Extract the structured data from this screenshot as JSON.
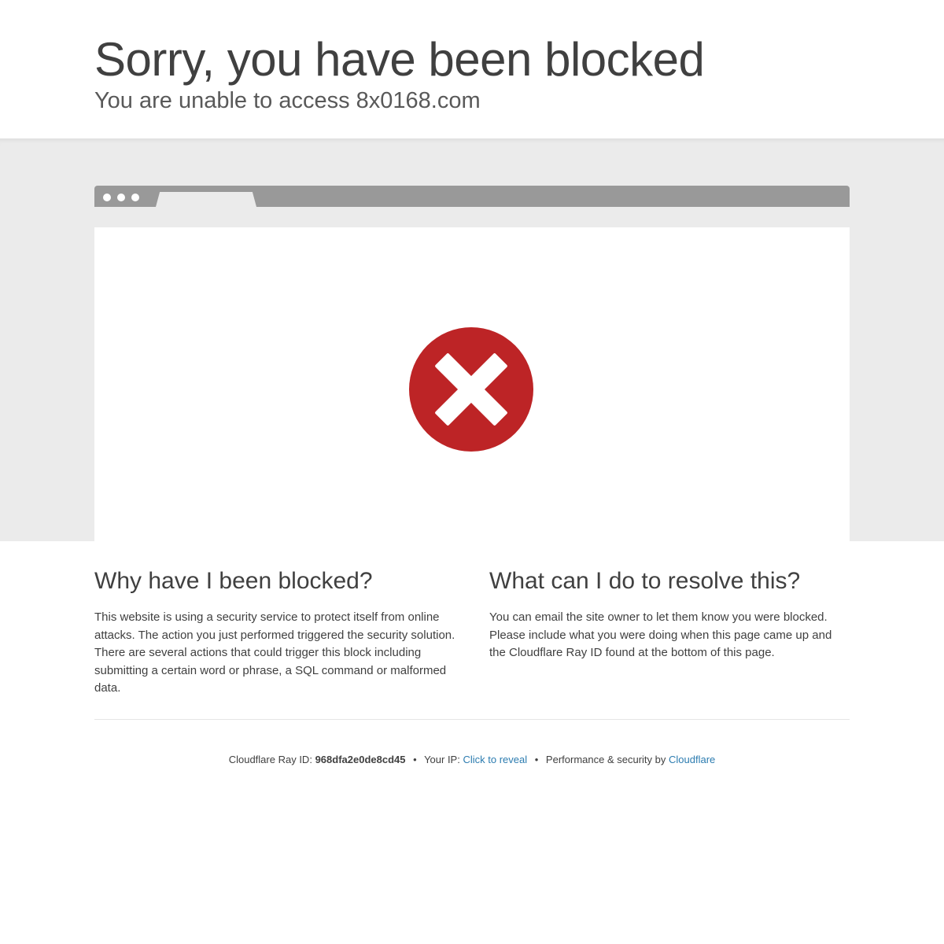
{
  "header": {
    "title": "Sorry, you have been blocked",
    "subtitle": "You are unable to access 8x0168.com"
  },
  "icon": {
    "name": "block-error-icon",
    "color": "#bd2426"
  },
  "sections": {
    "why": {
      "heading": "Why have I been blocked?",
      "body": "This website is using a security service to protect itself from online attacks. The action you just performed triggered the security solution. There are several actions that could trigger this block including submitting a certain word or phrase, a SQL command or malformed data."
    },
    "resolve": {
      "heading": "What can I do to resolve this?",
      "body": "You can email the site owner to let them know you were blocked. Please include what you were doing when this page came up and the Cloudflare Ray ID found at the bottom of this page."
    }
  },
  "footer": {
    "ray_label": "Cloudflare Ray ID:",
    "ray_id": "968dfa2e0de8cd45",
    "separator": "•",
    "ip_label": "Your IP:",
    "ip_link": "Click to reveal",
    "perf_label": "Performance & security by",
    "cloudflare_link": "Cloudflare"
  },
  "colors": {
    "band": "#ebebeb",
    "browser_bar": "#999999",
    "link": "#2c7cb0"
  }
}
